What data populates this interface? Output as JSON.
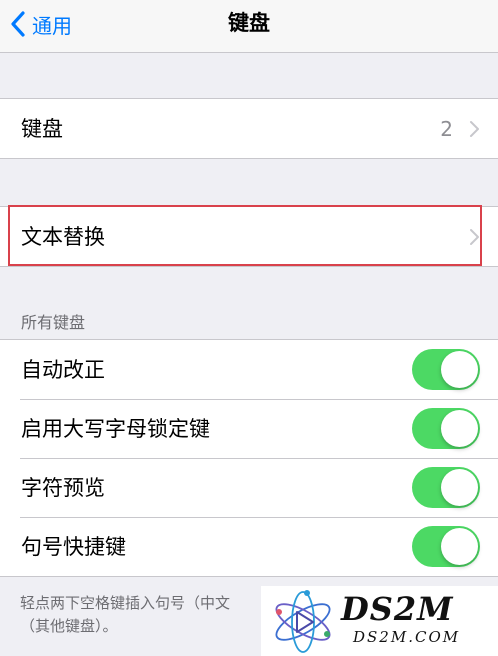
{
  "nav": {
    "back_label": "通用",
    "title": "键盘"
  },
  "group1": {
    "keyboards": {
      "label": "键盘",
      "value": "2"
    }
  },
  "group2": {
    "text_replacement": {
      "label": "文本替换"
    }
  },
  "all_keyboards": {
    "header": "所有键盘",
    "toggles": [
      {
        "label": "自动改正",
        "on": true
      },
      {
        "label": "启用大写字母锁定键",
        "on": true
      },
      {
        "label": "字符预览",
        "on": true
      },
      {
        "label": "句号快捷键",
        "on": true
      }
    ],
    "footer_line1": "轻点两下空格键插入句号（中文",
    "footer_line2": "（其他键盘）。"
  },
  "watermark": {
    "brand": "DS2M",
    "url": "DS2M.COM"
  },
  "colors": {
    "accent": "#007aff",
    "toggle_on": "#4cd964",
    "highlight": "#d9414b",
    "background": "#efeff4"
  }
}
